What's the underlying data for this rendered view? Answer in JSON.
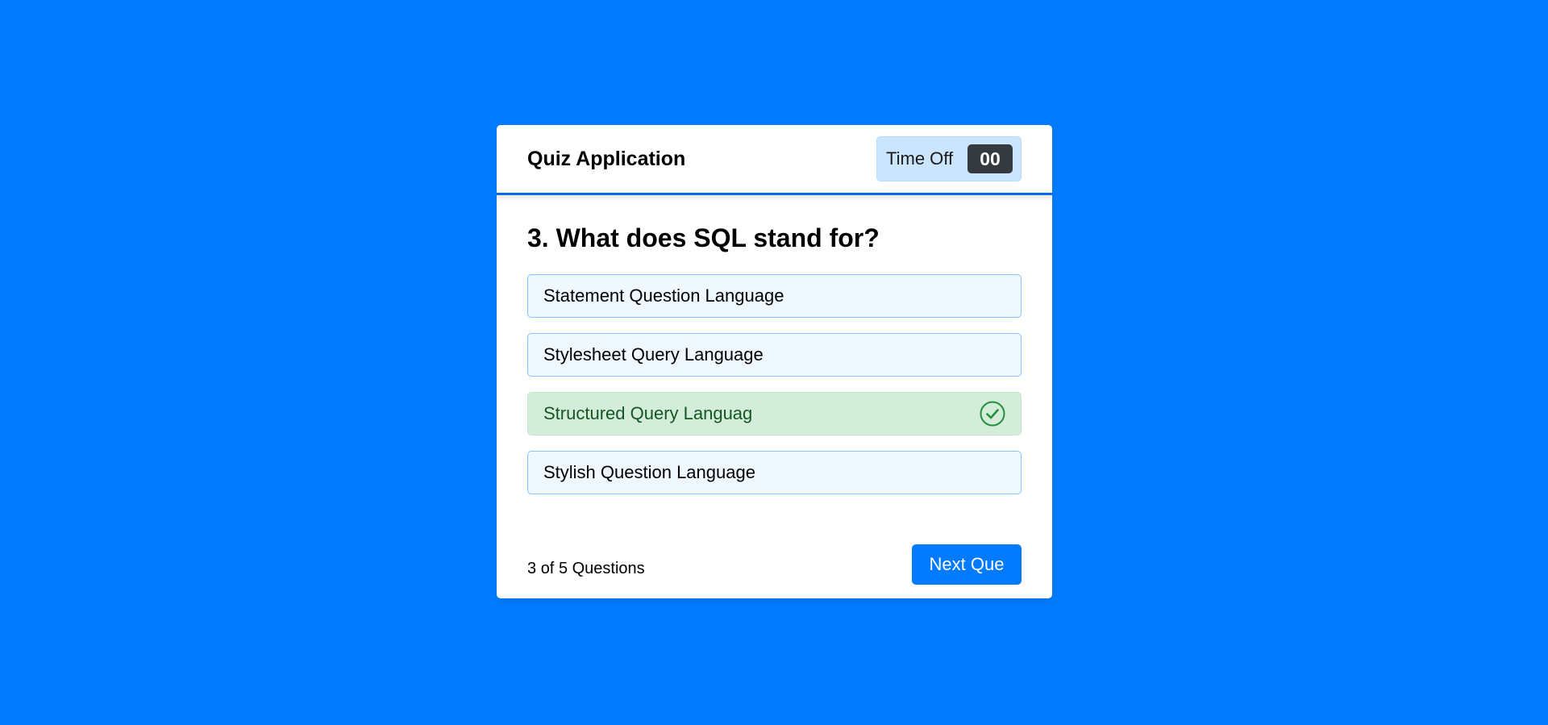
{
  "header": {
    "title": "Quiz Application",
    "timer_label": "Time Off",
    "timer_value": "00"
  },
  "question": {
    "text": "3. What does SQL stand for?",
    "options": [
      {
        "label": "Statement Question Language",
        "state": "default"
      },
      {
        "label": "Stylesheet Query Language",
        "state": "default"
      },
      {
        "label": "Structured Query Languag",
        "state": "correct",
        "icon": "check-circle-icon"
      },
      {
        "label": "Stylish Question Language",
        "state": "default"
      }
    ]
  },
  "footer": {
    "current": "3",
    "of_text": "of",
    "total": "5",
    "questions_text": "Questions",
    "next_label": "Next Que"
  },
  "colors": {
    "background": "#007bff",
    "accent": "#007bff",
    "correct_bg": "#d4edda",
    "correct_text": "#155724",
    "option_bg": "#f0f8ff",
    "option_border": "#84c5fe"
  }
}
